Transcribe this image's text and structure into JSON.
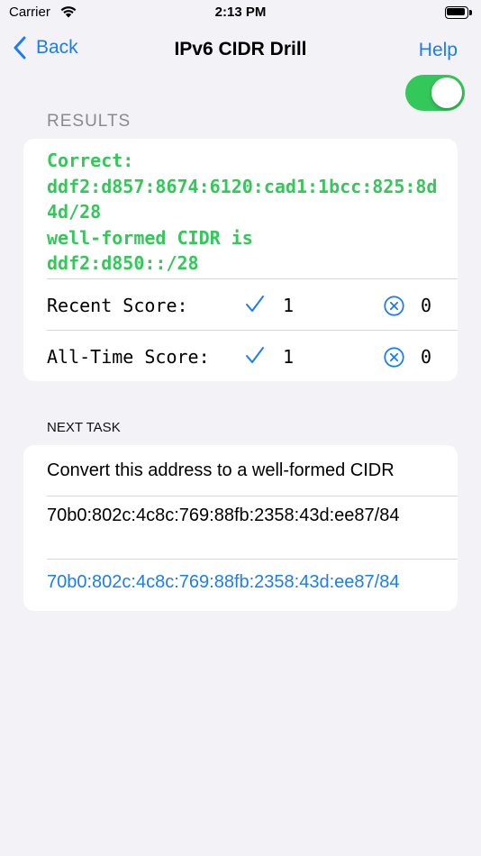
{
  "status_bar": {
    "carrier": "Carrier",
    "time": "2:13 PM"
  },
  "nav": {
    "back_label": "Back",
    "title": "IPv6 CIDR Drill",
    "help_label": "Help"
  },
  "toggle": {
    "on": true,
    "color": "#34c759"
  },
  "results": {
    "header": "RESULTS",
    "feedback": "Correct:\nddf2:d857:8674:6120:cad1:1bcc:825:8d4d/28\nwell-formed CIDR is\nddf2:d850::/28",
    "feedback_color": "#34c759",
    "recent": {
      "label": "Recent Score:",
      "correct": "1",
      "wrong": "0"
    },
    "all_time": {
      "label": "All-Time Score:",
      "correct": "1",
      "wrong": "0"
    }
  },
  "next_task": {
    "header": "NEXT TASK",
    "instruction": "Convert this address to a well-formed CIDR",
    "address": "70b0:802c:4c8c:769:88fb:2358:43d:ee87/84",
    "answer_value": "70b0:802c:4c8c:769:88fb:2358:43d:ee87/84"
  },
  "accent_color": "#1a7df5"
}
